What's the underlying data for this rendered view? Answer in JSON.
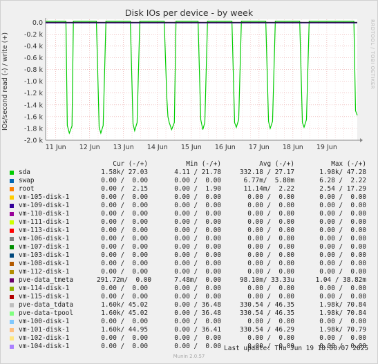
{
  "title": "Disk IOs per device - by week",
  "watermark": "RRDTOOL / TOBI OETIKER",
  "chart_data": {
    "type": "line",
    "ylabel": "IOs/second read (-) / write (+)",
    "ylim": [
      -2000,
      50
    ],
    "yticks": [
      {
        "value": 0,
        "label": "0.0"
      },
      {
        "value": -200,
        "label": "-0.2 k"
      },
      {
        "value": -400,
        "label": "-0.4 k"
      },
      {
        "value": -600,
        "label": "-0.6 k"
      },
      {
        "value": -800,
        "label": "-0.8 k"
      },
      {
        "value": -1000,
        "label": "-1.0 k"
      },
      {
        "value": -1200,
        "label": "-1.2 k"
      },
      {
        "value": -1400,
        "label": "-1.4 k"
      },
      {
        "value": -1600,
        "label": "-1.6 k"
      },
      {
        "value": -1800,
        "label": "-1.8 k"
      },
      {
        "value": -2000,
        "label": "-2.0 k"
      }
    ],
    "xlim": [
      10.7,
      19.9
    ],
    "xticks": [
      {
        "value": 11,
        "label": "11 Jun"
      },
      {
        "value": 12,
        "label": "12 Jun"
      },
      {
        "value": 13,
        "label": "13 Jun"
      },
      {
        "value": 14,
        "label": "14 Jun"
      },
      {
        "value": 15,
        "label": "15 Jun"
      },
      {
        "value": 16,
        "label": "16 Jun"
      },
      {
        "value": 17,
        "label": "17 Jun"
      },
      {
        "value": 18,
        "label": "18 Jun"
      },
      {
        "value": 19,
        "label": "19 Jun"
      }
    ],
    "grid": true,
    "series": [
      {
        "name": "sda",
        "color": "#00cc00",
        "x": [
          10.7,
          11.2,
          11.3,
          11.34,
          11.4,
          11.48,
          11.52,
          11.6,
          12.2,
          12.28,
          12.33,
          12.4,
          12.48,
          12.53,
          12.6,
          13.2,
          13.28,
          13.33,
          13.4,
          13.48,
          13.53,
          13.6,
          14.2,
          14.28,
          14.31,
          14.35,
          14.42,
          14.5,
          14.55,
          14.62,
          15.15,
          15.2,
          15.28,
          15.34,
          15.4,
          15.48,
          15.52,
          15.6,
          16.2,
          16.28,
          16.33,
          16.4,
          16.48,
          16.53,
          16.6,
          17.2,
          17.28,
          17.33,
          17.4,
          17.48,
          17.53,
          17.6,
          18.2,
          18.28,
          18.33,
          18.4,
          18.48,
          18.53,
          18.6,
          19.7,
          19.8,
          19.85,
          19.9
        ],
        "y": [
          20,
          20,
          20,
          -1750,
          -1880,
          -1760,
          20,
          20,
          20,
          -1780,
          -1880,
          -1750,
          20,
          20,
          20,
          20,
          -1720,
          -1840,
          -1700,
          20,
          20,
          20,
          20,
          -1300,
          -1600,
          -1700,
          -1820,
          -1700,
          20,
          20,
          20,
          20,
          -1650,
          -1820,
          -1700,
          20,
          20,
          20,
          20,
          -1700,
          -1780,
          -1650,
          20,
          20,
          20,
          20,
          -1680,
          -1800,
          -1680,
          20,
          20,
          20,
          20,
          -1700,
          -1780,
          -1650,
          20,
          20,
          20,
          20,
          20,
          -1500,
          -1580
        ]
      },
      {
        "name": "pve-data_tmeta",
        "color": "#330099",
        "x": [
          10.7,
          19.9
        ],
        "y": [
          -10,
          -10
        ]
      }
    ]
  },
  "legend": {
    "headers": {
      "cur": "Cur (-/+)",
      "min": "Min (-/+)",
      "avg": "Avg (-/+)",
      "max": "Max (-/+)"
    },
    "rows": [
      {
        "name": "sda",
        "color": "#00cc00",
        "cur": "1.58k/ 27.03",
        "min": "4.11 / 21.78",
        "avg": "332.18 / 27.17",
        "max": "1.98k/ 47.28"
      },
      {
        "name": "swap",
        "color": "#0066b3",
        "cur": "0.00 /  0.00",
        "min": "0.00 /  0.00",
        "avg": "6.77m/  5.80m",
        "max": "6.28 /  2.22"
      },
      {
        "name": "root",
        "color": "#ff8000",
        "cur": "0.00 /  2.15",
        "min": "0.00 /  1.90",
        "avg": "11.14m/  2.22",
        "max": "2.54 / 17.29"
      },
      {
        "name": "vm-105-disk-1",
        "color": "#ffcc00",
        "cur": "0.00 /  0.00",
        "min": "0.00 /  0.00",
        "avg": "0.00 /  0.00",
        "max": "0.00 /  0.00"
      },
      {
        "name": "vm-109-disk-1",
        "color": "#330099",
        "cur": "0.00 /  0.00",
        "min": "0.00 /  0.00",
        "avg": "0.00 /  0.00",
        "max": "0.00 /  0.00"
      },
      {
        "name": "vm-110-disk-1",
        "color": "#990099",
        "cur": "0.00 /  0.00",
        "min": "0.00 /  0.00",
        "avg": "0.00 /  0.00",
        "max": "0.00 /  0.00"
      },
      {
        "name": "vm-111-disk-1",
        "color": "#ccff00",
        "cur": "0.00 /  0.00",
        "min": "0.00 /  0.00",
        "avg": "0.00 /  0.00",
        "max": "0.00 /  0.00"
      },
      {
        "name": "vm-113-disk-1",
        "color": "#ff0000",
        "cur": "0.00 /  0.00",
        "min": "0.00 /  0.00",
        "avg": "0.00 /  0.00",
        "max": "0.00 /  0.00"
      },
      {
        "name": "vm-106-disk-1",
        "color": "#808080",
        "cur": "0.00 /  0.00",
        "min": "0.00 /  0.00",
        "avg": "0.00 /  0.00",
        "max": "0.00 /  0.00"
      },
      {
        "name": "vm-107-disk-1",
        "color": "#008f00",
        "cur": "0.00 /  0.00",
        "min": "0.00 /  0.00",
        "avg": "0.00 /  0.00",
        "max": "0.00 /  0.00"
      },
      {
        "name": "vm-103-disk-1",
        "color": "#00487d",
        "cur": "0.00 /  0.00",
        "min": "0.00 /  0.00",
        "avg": "0.00 /  0.00",
        "max": "0.00 /  0.00"
      },
      {
        "name": "vm-108-disk-1",
        "color": "#b35a00",
        "cur": "0.00 /  0.00",
        "min": "0.00 /  0.00",
        "avg": "0.00 /  0.00",
        "max": "0.00 /  0.00"
      },
      {
        "name": "vm-112-disk-1",
        "color": "#b38f00",
        "cur": "0.00 /  0.00",
        "min": "0.00 /  0.00",
        "avg": "0.00 /  0.00",
        "max": "0.00 /  0.00"
      },
      {
        "name": "pve-data_tmeta",
        "color": "#6b006b",
        "cur": "291.72m/  0.00",
        "min": "7.48m/  0.00",
        "avg": "98.10m/ 33.33u",
        "max": "1.04 / 38.82m"
      },
      {
        "name": "vm-114-disk-1",
        "color": "#8fb300",
        "cur": "0.00 /  0.00",
        "min": "0.00 /  0.00",
        "avg": "0.00 /  0.00",
        "max": "0.00 /  0.00"
      },
      {
        "name": "vm-115-disk-1",
        "color": "#b30000",
        "cur": "0.00 /  0.00",
        "min": "0.00 /  0.00",
        "avg": "0.00 /  0.00",
        "max": "0.00 /  0.00"
      },
      {
        "name": "pve-data_tdata",
        "color": "#bebebe",
        "cur": "1.60k/ 45.02",
        "min": "0.00 / 36.48",
        "avg": "330.54 / 46.35",
        "max": "1.98k/ 70.84"
      },
      {
        "name": "pve-data-tpool",
        "color": "#80ff80",
        "cur": "1.60k/ 45.02",
        "min": "0.00 / 36.48",
        "avg": "330.54 / 46.35",
        "max": "1.98k/ 70.84"
      },
      {
        "name": "vm-100-disk-1",
        "color": "#80c9ff",
        "cur": "0.00 /  0.00",
        "min": "0.00 /  0.00",
        "avg": "0.00 /  0.00",
        "max": "0.00 /  0.00"
      },
      {
        "name": "vm-101-disk-1",
        "color": "#ffc080",
        "cur": "1.60k/ 44.95",
        "min": "0.00 / 36.41",
        "avg": "330.54 / 46.29",
        "max": "1.98k/ 70.79"
      },
      {
        "name": "vm-102-disk-1",
        "color": "#ffe680",
        "cur": "0.00 /  0.00",
        "min": "0.00 /  0.00",
        "avg": "0.00 /  0.00",
        "max": "0.00 /  0.00"
      },
      {
        "name": "vm-104-disk-1",
        "color": "#aa80ff",
        "cur": "0.00 /  0.00",
        "min": "0.00 /  0.00",
        "avg": "0.00 /  0.00",
        "max": "0.00 /  0.00"
      }
    ]
  },
  "footer": {
    "last_update": "Last update: Thu Jun 19 18:00:07 2025",
    "munin": "Munin 2.0.57"
  }
}
